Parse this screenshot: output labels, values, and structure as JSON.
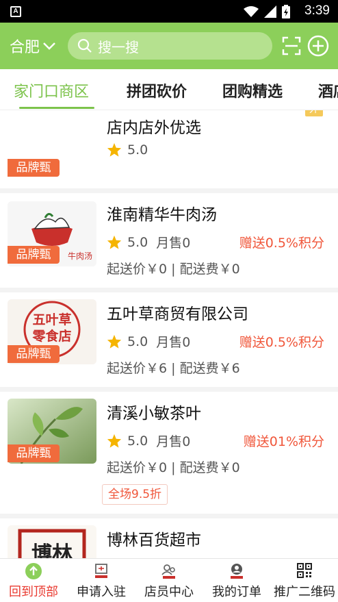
{
  "status_bar": {
    "time": "3:39"
  },
  "header": {
    "city": "合肥",
    "search_placeholder": "搜一搜"
  },
  "tabs": [
    {
      "label": "家门口商区",
      "active": true
    },
    {
      "label": "拼团砍价",
      "active": false
    },
    {
      "label": "团购精选",
      "active": false
    },
    {
      "label": "酒店",
      "active": false
    }
  ],
  "shops": [
    {
      "name": "店内店外优选",
      "rating": "5.0",
      "badge": "品牌甄",
      "tag": "外"
    },
    {
      "name": "淮南精华牛肉汤",
      "rating": "5.0",
      "monthly_sales": "月售0",
      "points": "赠送0.5%积分",
      "delivery": "起送价￥0 | 配送费￥0",
      "badge": "品牌甄",
      "thumb_text": "牛肉汤"
    },
    {
      "name": "五叶草商贸有限公司",
      "rating": "5.0",
      "monthly_sales": "月售0",
      "points": "赠送0.5%积分",
      "delivery": "起送价￥6 | 配送费￥6",
      "badge": "品牌甄",
      "thumb_text": "五叶草\n零食店"
    },
    {
      "name": "清溪小敏茶叶",
      "rating": "5.0",
      "monthly_sales": "月售0",
      "points": "赠送01%积分",
      "delivery": "起送价￥0 | 配送费￥0",
      "promo": "全场9.5折",
      "badge": "品牌甄"
    },
    {
      "name": "博林百货超市",
      "thumb_text": "博林"
    }
  ],
  "bottom_nav": [
    {
      "label": "回到顶部",
      "active": true,
      "icon": "arrow-up-icon"
    },
    {
      "label": "申请入驻",
      "active": false,
      "icon": "apply-icon"
    },
    {
      "label": "店员中心",
      "active": false,
      "icon": "staff-icon"
    },
    {
      "label": "我的订单",
      "active": false,
      "icon": "order-icon"
    },
    {
      "label": "推广二维码",
      "active": false,
      "icon": "qrcode-icon"
    }
  ],
  "colors": {
    "accent": "#8ccf5a",
    "badge": "#f06b3c",
    "points": "#f0563a",
    "star": "#f5b400"
  }
}
